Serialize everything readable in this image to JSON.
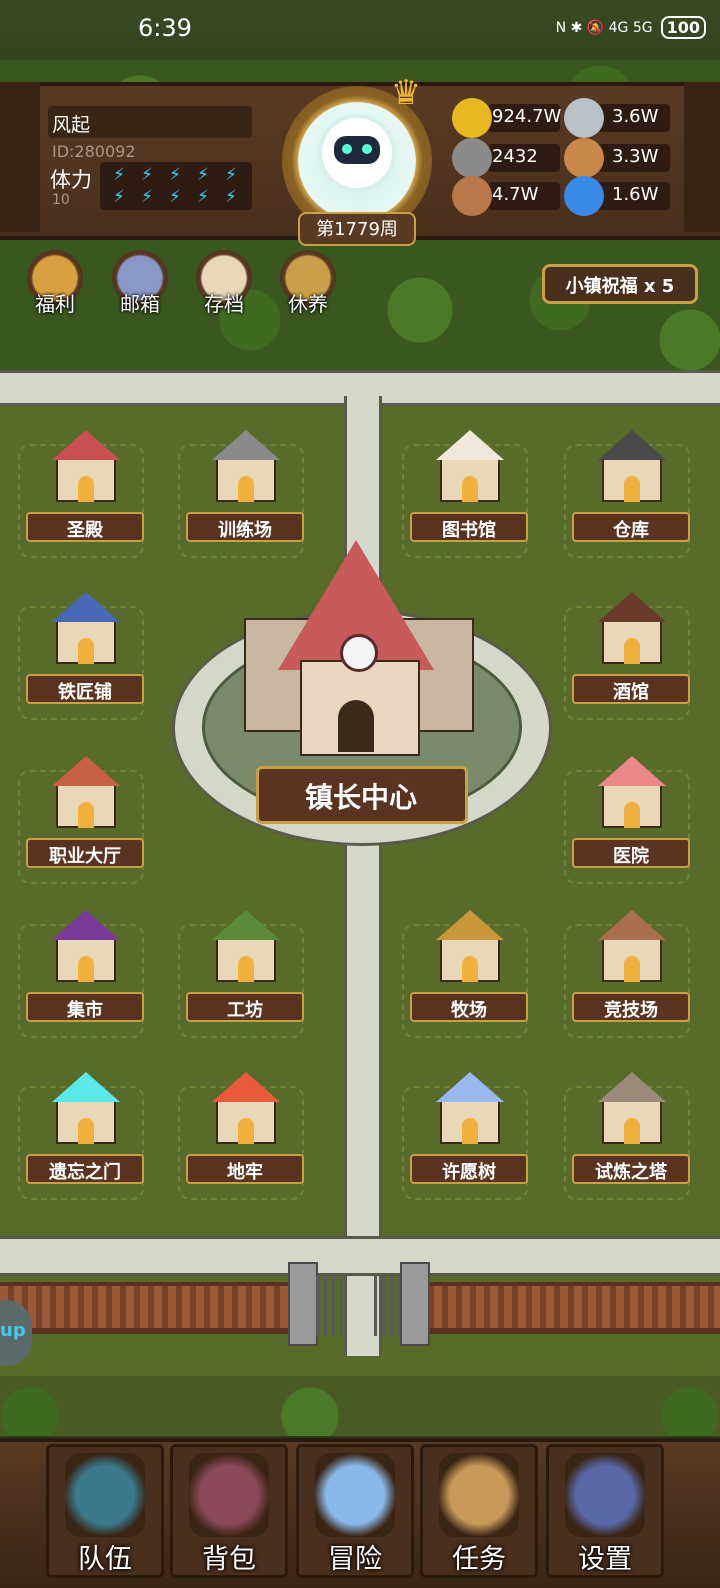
{
  "status_bar": {
    "time": "6:39",
    "icons": "N ✱ 🔕 4G 5G",
    "battery": "100"
  },
  "player": {
    "name": "风起",
    "id": "ID:280092",
    "stamina_label": "体力",
    "stamina_count": "10",
    "stamina_bolts": 10
  },
  "week": "第1779周",
  "resources": [
    {
      "icon": "gold-coin-icon",
      "value": "924.7W",
      "color": "#e8b820"
    },
    {
      "icon": "iron-ingot-icon",
      "value": "3.6W",
      "color": "#b8c0c8"
    },
    {
      "icon": "stone-ore-icon",
      "value": "2432",
      "color": "#8a8a8a"
    },
    {
      "icon": "leather-hide-icon",
      "value": "3.3W",
      "color": "#c8884a"
    },
    {
      "icon": "wood-log-icon",
      "value": "4.7W",
      "color": "#b8784a"
    },
    {
      "icon": "crystal-gem-icon",
      "value": "1.6W",
      "color": "#3a8ae8"
    }
  ],
  "shortcuts": [
    {
      "name": "welfare",
      "label": "福利",
      "color": "#d8a040"
    },
    {
      "name": "mailbox",
      "label": "邮箱",
      "color": "#8a98c8"
    },
    {
      "name": "save",
      "label": "存档",
      "color": "#e8d8b8"
    },
    {
      "name": "rest",
      "label": "休养",
      "color": "#c8a048"
    }
  ],
  "blessing": "小镇祝福 x 5",
  "buildings": [
    {
      "name": "cathedral",
      "label": "圣殿",
      "roof": "#c85050"
    },
    {
      "name": "training-ground",
      "label": "训练场",
      "roof": "#8a8a8a"
    },
    {
      "name": "library",
      "label": "图书馆",
      "roof": "#f0e8d8"
    },
    {
      "name": "warehouse",
      "label": "仓库",
      "roof": "#4a4a4a"
    },
    {
      "name": "blacksmith",
      "label": "铁匠铺",
      "roof": "#4a68b8"
    },
    {
      "name": "tavern",
      "label": "酒馆",
      "roof": "#6a3a2a"
    },
    {
      "name": "job-hall",
      "label": "职业大厅",
      "roof": "#c86048"
    },
    {
      "name": "hospital",
      "label": "医院",
      "roof": "#e88888"
    },
    {
      "name": "market",
      "label": "集市",
      "roof": "#7a3a9a"
    },
    {
      "name": "workshop",
      "label": "工坊",
      "roof": "#5a8a3a"
    },
    {
      "name": "ranch",
      "label": "牧场",
      "roof": "#c8983a"
    },
    {
      "name": "arena",
      "label": "竞技场",
      "roof": "#a87050"
    },
    {
      "name": "forgotten-gate",
      "label": "遗忘之门",
      "roof": "#5ae8e8"
    },
    {
      "name": "dungeon",
      "label": "地牢",
      "roof": "#e85a3a"
    },
    {
      "name": "wishing-tree",
      "label": "许愿树",
      "roof": "#9ab8f0"
    },
    {
      "name": "trial-tower",
      "label": "试炼之塔",
      "roof": "#9a8a7a"
    }
  ],
  "town_hall": "镇长中心",
  "side_tab": "up",
  "nav": [
    {
      "name": "team",
      "label": "队伍",
      "color": "#3a7a8a"
    },
    {
      "name": "backpack",
      "label": "背包",
      "color": "#8a4a5a"
    },
    {
      "name": "adventure",
      "label": "冒险",
      "color": "#8ab8e8"
    },
    {
      "name": "quest",
      "label": "任务",
      "color": "#c89a5a"
    },
    {
      "name": "settings",
      "label": "设置",
      "color": "#5a68a8"
    }
  ]
}
